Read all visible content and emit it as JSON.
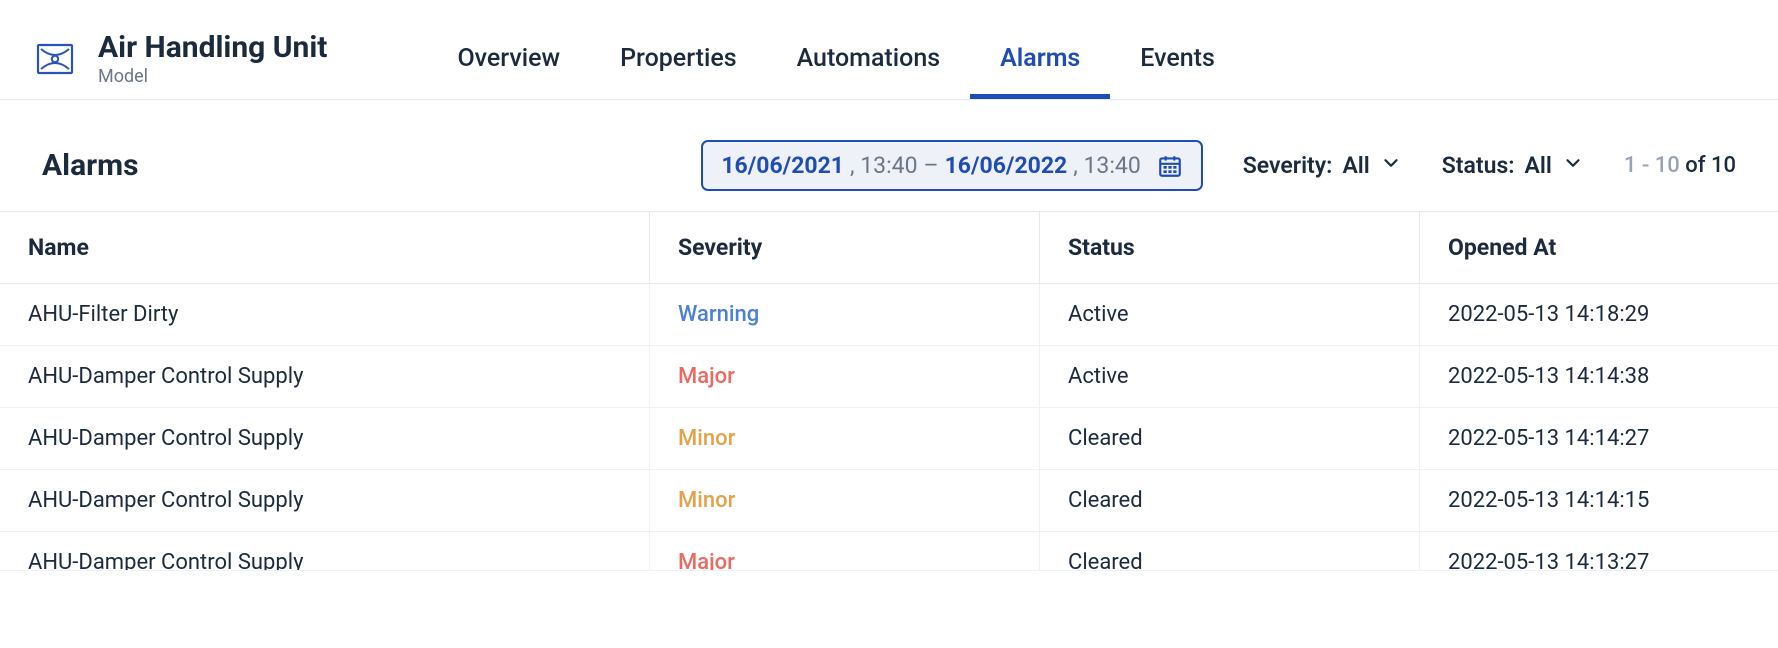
{
  "header": {
    "title": "Air Handling Unit",
    "subtitle": "Model",
    "tabs": [
      {
        "label": "Overview",
        "active": false
      },
      {
        "label": "Properties",
        "active": false
      },
      {
        "label": "Automations",
        "active": false
      },
      {
        "label": "Alarms",
        "active": true
      },
      {
        "label": "Events",
        "active": false
      }
    ]
  },
  "toolbar": {
    "section_title": "Alarms",
    "daterange": {
      "start_date": "16/06/2021",
      "start_time": ", 13:40",
      "separator": " – ",
      "end_date": "16/06/2022",
      "end_time": ", 13:40"
    },
    "filter_severity": {
      "label": "Severity: ",
      "value": "All"
    },
    "filter_status": {
      "label": "Status: ",
      "value": "All"
    },
    "pager": {
      "range": "1 - 10",
      "of_text": " of 10"
    }
  },
  "table": {
    "columns": [
      "Name",
      "Severity",
      "Status",
      "Opened At"
    ],
    "rows": [
      {
        "name": "AHU-Filter Dirty",
        "severity": "Warning",
        "sev_class": "sev-warning",
        "status": "Active",
        "opened": "2022-05-13 14:18:29"
      },
      {
        "name": "AHU-Damper Control Supply",
        "severity": "Major",
        "sev_class": "sev-major",
        "status": "Active",
        "opened": "2022-05-13 14:14:38"
      },
      {
        "name": "AHU-Damper Control Supply",
        "severity": "Minor",
        "sev_class": "sev-minor",
        "status": "Cleared",
        "opened": "2022-05-13 14:14:27"
      },
      {
        "name": "AHU-Damper Control Supply",
        "severity": "Minor",
        "sev_class": "sev-minor",
        "status": "Cleared",
        "opened": "2022-05-13 14:14:15"
      },
      {
        "name": "AHU-Damper Control Supply",
        "severity": "Major",
        "sev_class": "sev-major",
        "status": "Cleared",
        "opened": "2022-05-13 14:13:27"
      }
    ]
  }
}
